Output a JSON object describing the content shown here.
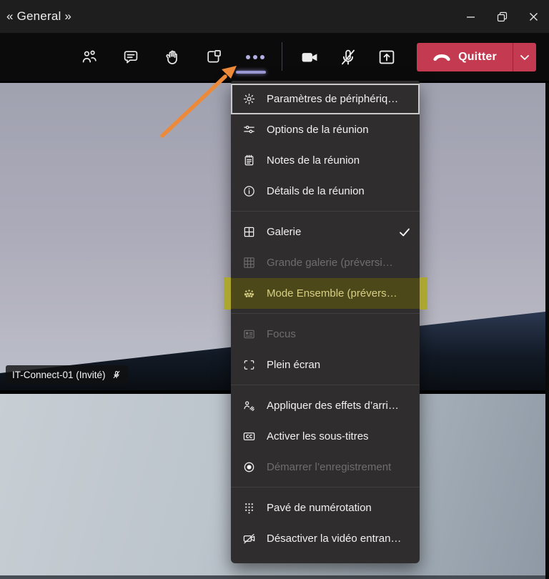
{
  "titlebar": {
    "title": "« General »"
  },
  "toolbar": {
    "quit": {
      "label": "Quitter"
    }
  },
  "icons": {
    "participants": "two-people",
    "chat": "speech-bubble",
    "raise_hand": "raised-hand",
    "breakout_rooms": "overlapping-squares",
    "more_options": "ellipsis-dots",
    "camera": "video-camera-filled",
    "mic_muted": "microphone-slash",
    "share_screen": "square-arrow-up",
    "hang_up": "phone-down-arc",
    "chevron": "chevron-down",
    "minimize": "dash",
    "restore": "overlapping-windows",
    "close": "x-mark"
  },
  "menu": {
    "items": [
      {
        "label": "Paramètres de périphériq…",
        "icon": "gear",
        "state": "focused"
      },
      {
        "label": "Options de la réunion",
        "icon": "sliders",
        "state": "normal"
      },
      {
        "label": "Notes de la réunion",
        "icon": "notepad",
        "state": "normal"
      },
      {
        "label": "Détails de la réunion",
        "icon": "info-circle",
        "state": "normal"
      },
      {
        "divider": true
      },
      {
        "label": "Galerie",
        "icon": "grid-2x2",
        "state": "checked"
      },
      {
        "label": "Grande galerie (préversi…",
        "icon": "grid-3x3",
        "state": "disabled"
      },
      {
        "label": "Mode Ensemble (prévers…",
        "icon": "together-mode-dots",
        "state": "highlighted"
      },
      {
        "divider": true
      },
      {
        "label": "Focus",
        "icon": "focus-content",
        "state": "disabled"
      },
      {
        "label": "Plein écran",
        "icon": "fullscreen-corners",
        "state": "normal"
      },
      {
        "divider": true
      },
      {
        "label": "Appliquer des effets d’arri…",
        "icon": "background-effects",
        "state": "normal"
      },
      {
        "label": "Activer les sous-titres",
        "icon": "closed-captions",
        "state": "normal"
      },
      {
        "label": "Démarrer l’enregistrement",
        "icon": "record-circle",
        "state": "disabled"
      },
      {
        "divider": true
      },
      {
        "label": "Pavé de numérotation",
        "icon": "dialpad",
        "state": "normal"
      },
      {
        "label": "Désactiver la vidéo entran…",
        "icon": "camera-off",
        "state": "normal"
      }
    ]
  },
  "video": {
    "participant_label": "IT-Connect-01 (Invité)",
    "participant_muted": true
  },
  "colors": {
    "accent_purple": "#B3B1E4",
    "quit_red": "#C43B51",
    "highlight_yellow": "#AEA827",
    "arrow_orange": "#EC8A3A",
    "menu_bg": "#2F2D2D"
  }
}
